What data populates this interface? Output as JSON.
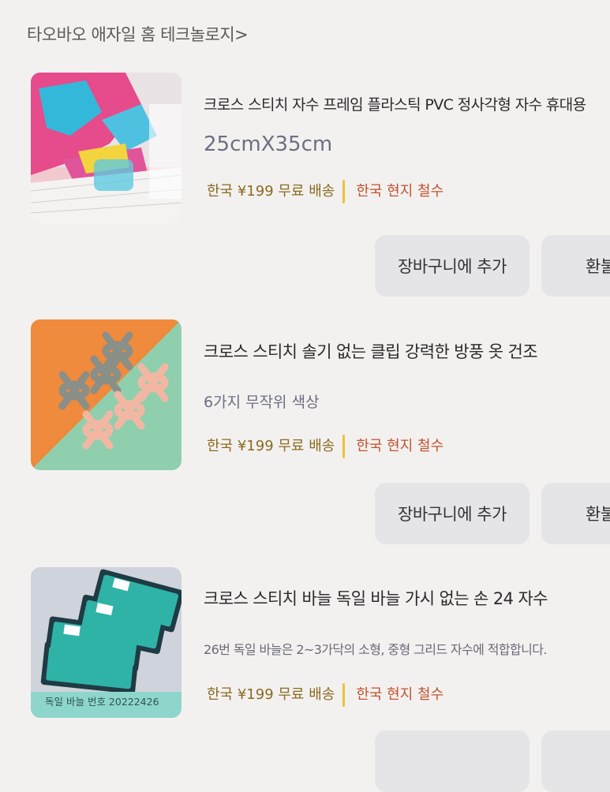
{
  "store": {
    "link_text": "타오바오 애자일 홈 테크놀로지>"
  },
  "items": [
    {
      "title": "크로스 스티치 자수 프레임 플라스틱 PVC 정사각형 자수 휴대용",
      "spec": "25cmX35cm",
      "tag_shipping": "한국 ¥199 무료 배송",
      "tag_local": "한국 현지 철수",
      "cart_label": "장바구니에 추가",
      "refund_label": "환불"
    },
    {
      "title": "크로스 스티치 솔기 없는 클립 강력한 방풍 옷 건조",
      "spec": "6가지 무작위 색상",
      "tag_shipping": "한국 ¥199 무료 배송",
      "tag_local": "한국 현지 철수",
      "cart_label": "장바구니에 추가",
      "refund_label": "환불"
    },
    {
      "title": "크로스 스티치 바늘 독일 바늘 가시 없는 손 24 자수",
      "spec": "26번 독일 바늘은 2~3가닥의 소형, 중형 그리드 자수에 적합합니다.",
      "thumb_caption": "독일 바늘 번호 20222426",
      "tag_shipping": "한국 ¥199 무료 배송",
      "tag_local": "한국 현지 철수"
    }
  ],
  "colors": {
    "accent_bar": "#f0c23a",
    "shipping_text": "#8b6a1f",
    "local_text": "#c0542e"
  }
}
